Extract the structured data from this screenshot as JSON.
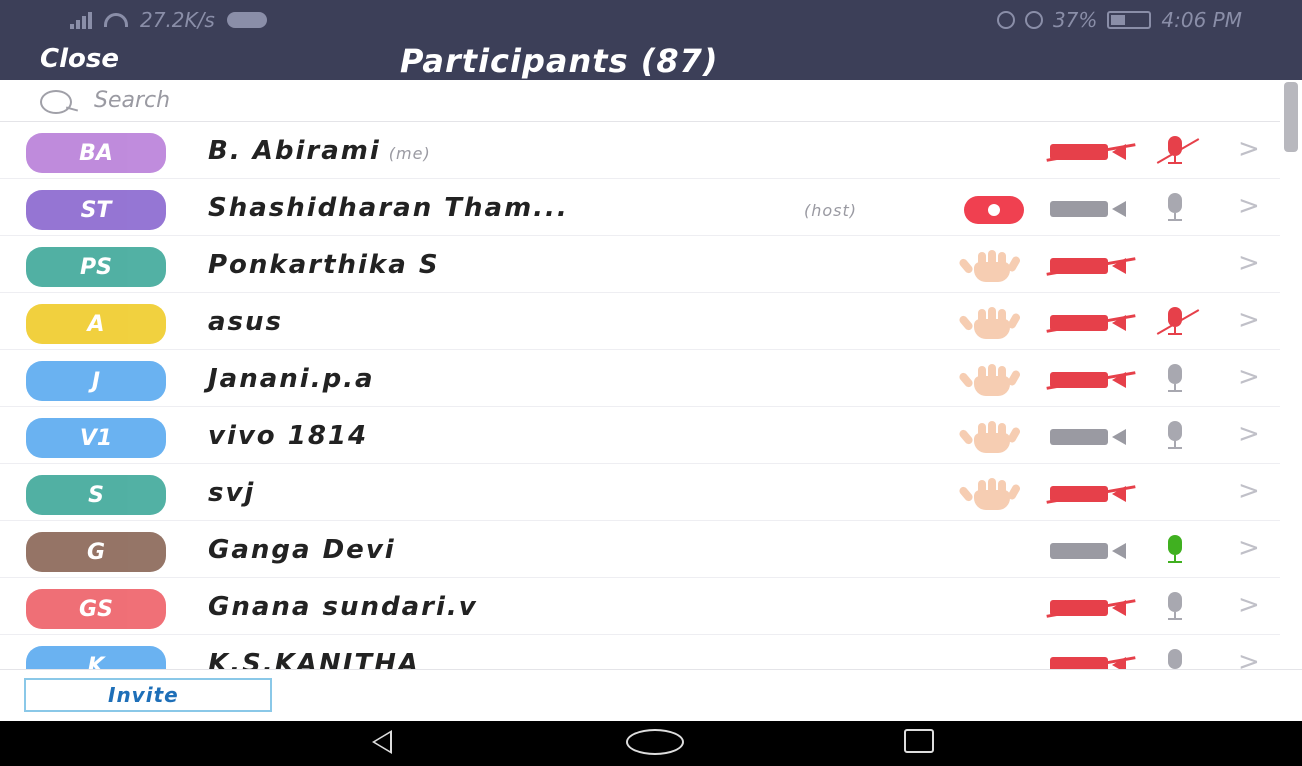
{
  "status_bar": {
    "speed": "27.2K/s",
    "battery": "37%",
    "time": "4:06 PM"
  },
  "header": {
    "close_label": "Close",
    "title": "Participants (87)"
  },
  "search": {
    "placeholder": "Search"
  },
  "participants": [
    {
      "initials": "BA",
      "color": "#b97fd9",
      "name": "B. Abirami",
      "tag": "(me)",
      "recording": false,
      "hand": false,
      "video": "off",
      "mic": "off"
    },
    {
      "initials": "ST",
      "color": "#8a67cf",
      "name": "Shashidharan Tham...",
      "tag": "(host)",
      "recording": true,
      "hand": false,
      "video": "on",
      "mic": "on"
    },
    {
      "initials": "PS",
      "color": "#3fa89a",
      "name": "Ponkarthika S",
      "tag": "",
      "recording": false,
      "hand": true,
      "video": "off",
      "mic": "none"
    },
    {
      "initials": "A",
      "color": "#f0cc2a",
      "name": "asus",
      "tag": "",
      "recording": false,
      "hand": true,
      "video": "off",
      "mic": "off"
    },
    {
      "initials": "J",
      "color": "#5aaaf0",
      "name": "Janani.p.a",
      "tag": "",
      "recording": false,
      "hand": true,
      "video": "off",
      "mic": "on"
    },
    {
      "initials": "V1",
      "color": "#5aaaf0",
      "name": "vivo 1814",
      "tag": "",
      "recording": false,
      "hand": true,
      "video": "on",
      "mic": "on"
    },
    {
      "initials": "S",
      "color": "#3fa89a",
      "name": "svj",
      "tag": "",
      "recording": false,
      "hand": true,
      "video": "off",
      "mic": "none"
    },
    {
      "initials": "G",
      "color": "#8a6656",
      "name": "Ganga Devi",
      "tag": "",
      "recording": false,
      "hand": false,
      "video": "on",
      "mic": "active"
    },
    {
      "initials": "GS",
      "color": "#ee6068",
      "name": "Gnana sundari.v",
      "tag": "",
      "recording": false,
      "hand": false,
      "video": "off",
      "mic": "on"
    },
    {
      "initials": "K",
      "color": "#5aaaf0",
      "name": "K.S.KANITHA",
      "tag": "",
      "recording": false,
      "hand": false,
      "video": "off",
      "mic": "on"
    }
  ],
  "footer": {
    "invite_label": "Invite"
  },
  "icons": {
    "row_chevron": ">"
  }
}
